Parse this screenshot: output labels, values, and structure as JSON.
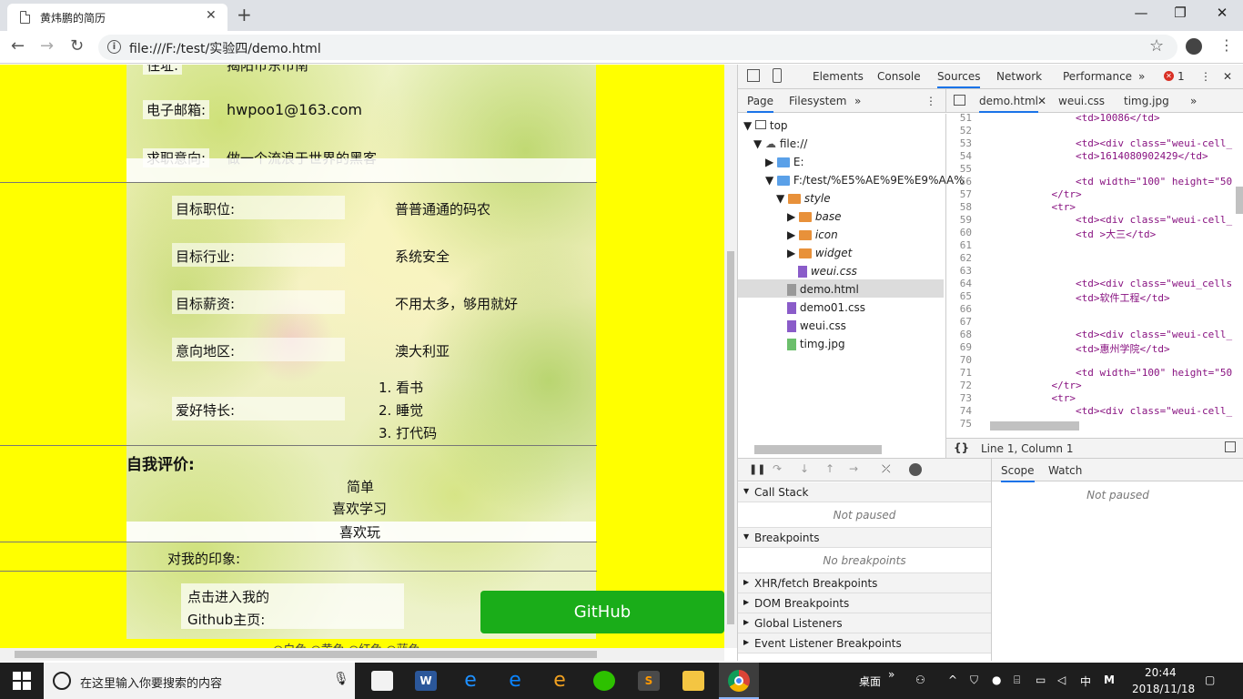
{
  "browser": {
    "tab_title": "黄炜鹏的简历",
    "close_tab": "✕",
    "new_tab": "+",
    "url": "file:///F:/test/实验四/demo.html",
    "window_controls": [
      "—",
      "❐",
      "✕"
    ]
  },
  "resume": {
    "top_cut": "住址:",
    "top_cut_value": "揭阳市东市南",
    "email_label": "电子邮箱:",
    "email": "hwpoo1@163.com",
    "intent_label": "求职意向:",
    "intent": "做一个流浪于世界的黑客",
    "rows": [
      {
        "label": "目标职位:",
        "value": "普普通通的码农"
      },
      {
        "label": "目标行业:",
        "value": "系统安全"
      },
      {
        "label": "目标薪资:",
        "value": "不用太多，够用就好"
      },
      {
        "label": "意向地区:",
        "value": "澳大利亚"
      }
    ],
    "hobby_label": "爱好特长:",
    "hobbies": [
      "1. 看书",
      "2. 睡觉",
      "3. 打代码"
    ],
    "self_title": "自我评价:",
    "self_items": [
      "简单",
      "喜欢学习",
      "喜欢玩"
    ],
    "impression_label": "对我的印象:",
    "github_label_1": "点击进入我的",
    "github_label_2": "Github主页:",
    "github_button": "GitHub",
    "bottom_cut": "○白色 ○黄色 ○红色 ○蓝色"
  },
  "devtools": {
    "tabs": [
      "Elements",
      "Console",
      "Sources",
      "Network",
      "Performance",
      "»"
    ],
    "error_count": "1",
    "nav_tabs": [
      "Page",
      "Filesystem",
      "»"
    ],
    "editor_tabs": [
      "demo.html",
      "weui.css",
      "timg.jpg",
      "»"
    ],
    "tree": [
      {
        "label": "top",
        "kind": "frame"
      },
      {
        "label": "file://",
        "kind": "cloud"
      },
      {
        "label": "E:",
        "kind": "folder-blue"
      },
      {
        "label": "F:/test/%E5%AE%9E%E9%AA%",
        "kind": "folder-blue"
      },
      {
        "label": "style",
        "kind": "folder"
      },
      {
        "label": "base",
        "kind": "folder"
      },
      {
        "label": "icon",
        "kind": "folder"
      },
      {
        "label": "widget",
        "kind": "folder"
      },
      {
        "label": "weui.css",
        "kind": "css"
      },
      {
        "label": "demo.html",
        "kind": "html"
      },
      {
        "label": "demo01.css",
        "kind": "css"
      },
      {
        "label": "weui.css",
        "kind": "css"
      },
      {
        "label": "timg.jpg",
        "kind": "img"
      }
    ],
    "code_lines": [
      {
        "n": "51",
        "t": "                <td>10086</td>"
      },
      {
        "n": "52",
        "t": ""
      },
      {
        "n": "53",
        "t": "                <td><div class=\"weui-cell_"
      },
      {
        "n": "54",
        "t": "                <td>1614080902429</td>"
      },
      {
        "n": "55",
        "t": ""
      },
      {
        "n": "56",
        "t": "                <td width=\"100\" height=\"50"
      },
      {
        "n": "57",
        "t": "            </tr>"
      },
      {
        "n": "58",
        "t": "            <tr>"
      },
      {
        "n": "59",
        "t": "                <td><div class=\"weui-cell_"
      },
      {
        "n": "60",
        "t": "                <td >大三</td>"
      },
      {
        "n": "61",
        "t": ""
      },
      {
        "n": "62",
        "t": ""
      },
      {
        "n": "63",
        "t": ""
      },
      {
        "n": "64",
        "t": "                <td><div class=\"weui_cells"
      },
      {
        "n": "65",
        "t": "                <td>软件工程</td>"
      },
      {
        "n": "66",
        "t": ""
      },
      {
        "n": "67",
        "t": ""
      },
      {
        "n": "68",
        "t": "                <td><div class=\"weui-cell_"
      },
      {
        "n": "69",
        "t": "                <td>惠州学院</td>"
      },
      {
        "n": "70",
        "t": ""
      },
      {
        "n": "71",
        "t": "                <td width=\"100\" height=\"50"
      },
      {
        "n": "72",
        "t": "            </tr>"
      },
      {
        "n": "73",
        "t": "            <tr>"
      },
      {
        "n": "74",
        "t": "                <td><div class=\"weui-cell_"
      },
      {
        "n": "75",
        "t": ""
      }
    ],
    "cursor_pos": "Line 1, Column 1",
    "format_btn": "{}",
    "sections": [
      "Call Stack",
      "Breakpoints",
      "XHR/fetch Breakpoints",
      "DOM Breakpoints",
      "Global Listeners",
      "Event Listener Breakpoints"
    ],
    "not_paused": "Not paused",
    "no_breakpoints": "No breakpoints",
    "scope_tabs": [
      "Scope",
      "Watch"
    ]
  },
  "taskbar": {
    "search_placeholder": "在这里输入你要搜索的内容",
    "desktop": "桌面",
    "ime": "中",
    "time": "20:44",
    "date": "2018/11/18"
  }
}
